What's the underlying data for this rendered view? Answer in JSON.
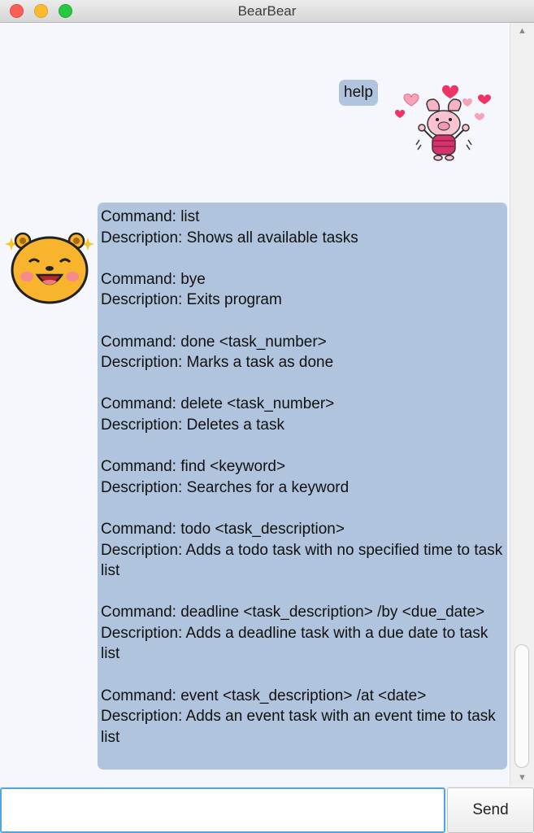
{
  "window": {
    "title": "BearBear"
  },
  "chat": {
    "user_message": "help",
    "bot_message": [
      {
        "cmd": "Command: list",
        "desc": "Description: Shows all available tasks"
      },
      {
        "cmd": "Command: bye",
        "desc": "Description: Exits program"
      },
      {
        "cmd": "Command: done <task_number>",
        "desc": "Description: Marks a task as done"
      },
      {
        "cmd": "Command: delete <task_number>",
        "desc": "Description: Deletes a task"
      },
      {
        "cmd": "Command: find <keyword>",
        "desc": "Description: Searches for a keyword"
      },
      {
        "cmd": "Command: todo <task_description>",
        "desc": "Description: Adds a todo task with no specified time to task list"
      },
      {
        "cmd": "Command: deadline <task_description> /by <due_date>",
        "desc": "Description: Adds a deadline task with a due date to task list"
      },
      {
        "cmd": "Command: event <task_description> /at <date>",
        "desc": "Description: Adds an event task with an event time to task list"
      }
    ]
  },
  "input": {
    "value": "",
    "send_label": "Send"
  },
  "icons": {
    "user_avatar": "pink-pig-hearts-avatar",
    "bot_avatar": "yellow-bear-sparkle-avatar",
    "scroll_up": "chevron-up-icon",
    "scroll_down": "chevron-down-icon"
  },
  "colors": {
    "bubble": "#b0c4de",
    "chat_background": "#f6f7fc",
    "input_focus": "#4fa7de"
  }
}
